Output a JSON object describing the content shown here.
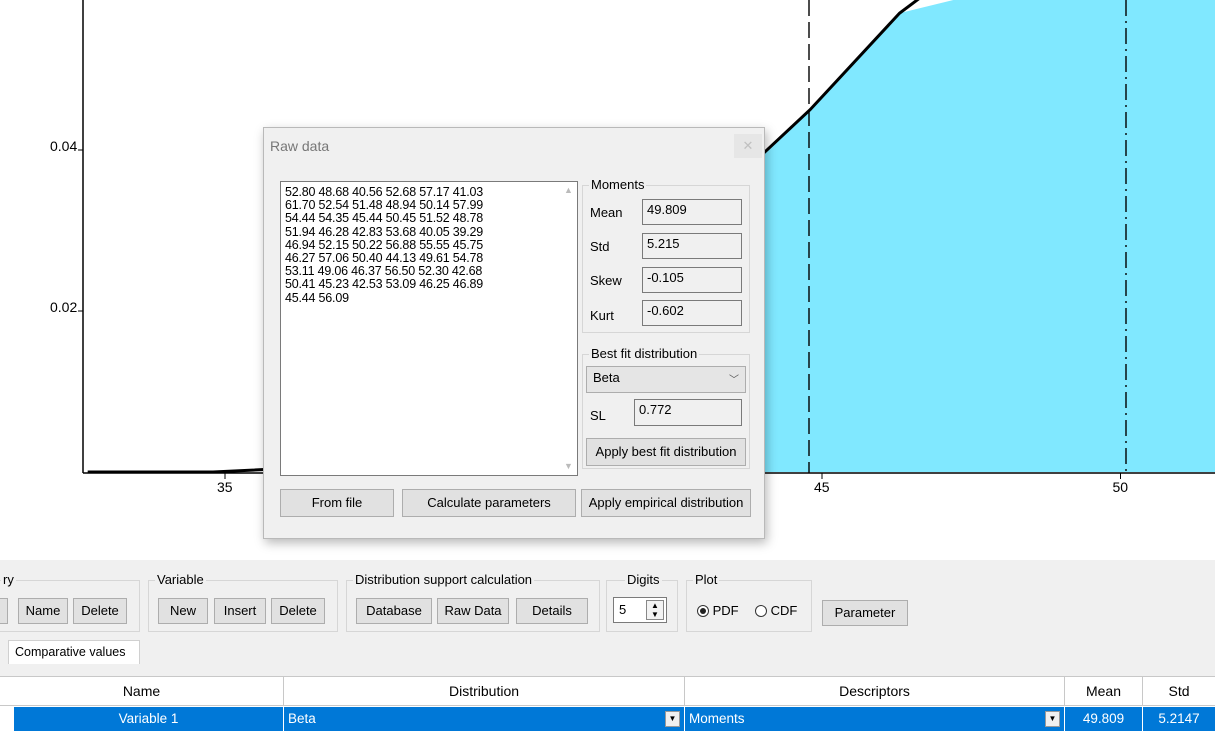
{
  "chart_data": {
    "type": "area",
    "x_ticks": [
      35,
      45,
      50
    ],
    "y_ticks": [
      0.02,
      0.04
    ],
    "x_tick_labels": [
      "35",
      "45",
      "50"
    ],
    "y_tick_labels": [
      "0.02",
      "0.04"
    ],
    "visible_xlim": [
      32.7,
      51.1
    ],
    "visible_ylim": [
      0,
      0.057
    ],
    "curve_x": [
      32.7,
      34.8,
      37,
      39.5,
      43.5,
      44.8,
      46.3,
      47.2
    ],
    "curve_y": [
      0.0,
      0.0,
      0.0008,
      0.005,
      0.036,
      0.045,
      0.057,
      0.062
    ],
    "shaded_from_x": 43.5,
    "dashed_lines_x": [
      44.6,
      49.8
    ],
    "fill_color": "#80e8ff",
    "line_color": "#000000"
  },
  "dialog": {
    "title": "Raw data",
    "close_icon": "close-icon",
    "raw_lines": [
      "52.80 48.68 40.56 52.68 57.17 41.03",
      "61.70 52.54 51.48 48.94 50.14 57.99",
      "54.44 54.35 45.44 50.45 51.52 48.78",
      "51.94 46.28 42.83 53.68 40.05 39.29",
      "46.94 52.15 50.22 56.88 55.55 45.75",
      "46.27 57.06 50.40 44.13 49.61 54.78",
      "53.11 49.06 46.37 56.50 52.30 42.68",
      "50.41 45.23 42.53 53.09 46.25 46.89",
      "45.44 56.09"
    ],
    "moments": {
      "label": "Moments",
      "mean_label": "Mean",
      "mean": "49.809",
      "std_label": "Std",
      "std": "5.215",
      "skew_label": "Skew",
      "skew": "-0.105",
      "kurt_label": "Kurt",
      "kurt": "-0.602"
    },
    "best_fit": {
      "label": "Best fit distribution",
      "selected": "Beta",
      "sl_label": "SL",
      "sl": "0.772",
      "apply_label": "Apply best fit distribution"
    },
    "buttons": {
      "from_file": "From file",
      "calculate": "Calculate parameters",
      "apply_empirical": "Apply empirical distribution"
    }
  },
  "panel": {
    "group_partial_label": "ry",
    "name_btn": "Name",
    "delete_btn1": "Delete",
    "variable_label": "Variable",
    "new_btn": "New",
    "insert_btn": "Insert",
    "delete_btn2": "Delete",
    "dist_support_label": "Distribution support calculation",
    "database_btn": "Database",
    "rawdata_btn": "Raw Data",
    "details_btn": "Details",
    "digits_label": "Digits",
    "digits_value": "5",
    "plot_label": "Plot",
    "pdf_label": "PDF",
    "cdf_label": "CDF",
    "parameter_btn": "Parameter",
    "tab_label": "Comparative values"
  },
  "grid": {
    "headers": [
      "Name",
      "Distribution",
      "Descriptors",
      "Mean",
      "Std"
    ],
    "row": [
      "Variable 1",
      "Beta",
      "Moments",
      "49.809",
      "5.2147"
    ]
  }
}
